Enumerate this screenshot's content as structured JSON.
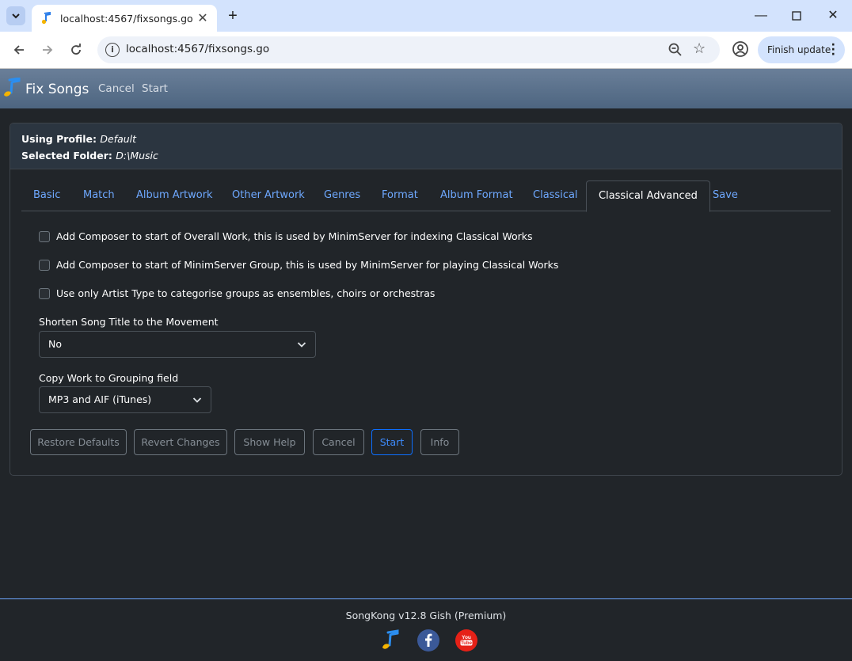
{
  "browser": {
    "tab_title": "localhost:4567/fixsongs.go",
    "url": "localhost:4567/fixsongs.go",
    "update_button": "Finish update"
  },
  "app": {
    "brand": "Fix Songs",
    "header_links": [
      "Cancel",
      "Start"
    ]
  },
  "card": {
    "profile_label": "Using Profile:",
    "profile_value": "Default",
    "folder_label": "Selected Folder:",
    "folder_value": "D:\\Music"
  },
  "tabs": [
    "Basic",
    "Match",
    "Album Artwork",
    "Other Artwork",
    "Genres",
    "Format",
    "Album Format",
    "Classical",
    "Classical Advanced",
    "Save"
  ],
  "active_tab": "Classical Advanced",
  "options": {
    "add_composer_overall": "Add Composer to start of Overall Work, this is used by MinimServer for indexing Classical Works",
    "add_composer_group": "Add Composer to start of MinimServer Group, this is used by MinimServer for playing Classical Works",
    "artist_type_only": "Use only Artist Type to categorise groups as ensembles, choirs or orchestras"
  },
  "shorten_title": {
    "label": "Shorten Song Title to the Movement",
    "value": "No"
  },
  "copy_work": {
    "label": "Copy Work to Grouping field",
    "value": "MP3 and AIF (iTunes)"
  },
  "buttons": {
    "restore": "Restore Defaults",
    "revert": "Revert Changes",
    "help": "Show Help",
    "cancel": "Cancel",
    "start": "Start",
    "info": "Info"
  },
  "footer": {
    "text": "SongKong v12.8 Gish (Premium)"
  },
  "colors": {
    "accent": "#0d6efd",
    "link": "#6ea8fe",
    "background": "#212529"
  }
}
